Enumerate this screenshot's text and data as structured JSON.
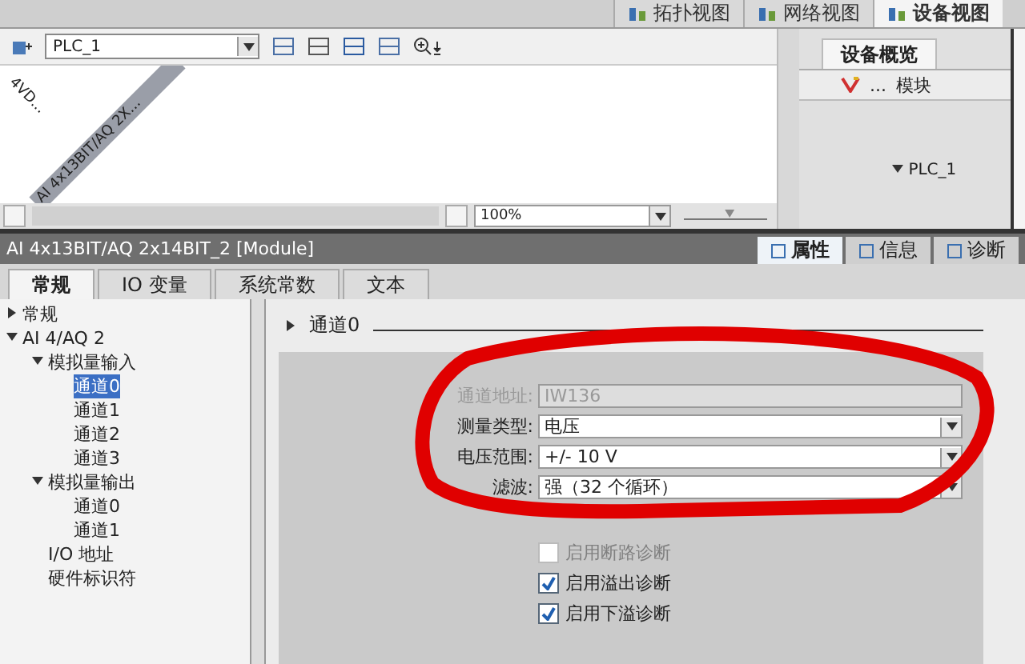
{
  "view_tabs": [
    {
      "label": "拓扑视图",
      "selected": false
    },
    {
      "label": "网络视图",
      "selected": false
    },
    {
      "label": "设备视图",
      "selected": true
    }
  ],
  "editor": {
    "device_select": "PLC_1",
    "canvas_labels": [
      "4VD...",
      "AI 4x13BIT/AQ 2X..."
    ],
    "zoom": "100%",
    "zoom_slider": {
      "level": 0.55
    }
  },
  "overview": {
    "tab": "设备概览",
    "columns": [
      "...",
      "模块"
    ],
    "rows": [
      {
        "label": "PLC_1",
        "expanded": true
      }
    ]
  },
  "inspector": {
    "title": "AI 4x13BIT/AQ 2x14BIT_2 [Module]",
    "panel_tabs": [
      {
        "label": "属性",
        "selected": true
      },
      {
        "label": "信息",
        "selected": false
      },
      {
        "label": "诊断",
        "selected": false
      }
    ],
    "tabs": [
      {
        "label": "常规",
        "selected": true
      },
      {
        "label": "IO 变量",
        "selected": false
      },
      {
        "label": "系统常数",
        "selected": false
      },
      {
        "label": "文本",
        "selected": false
      }
    ],
    "tree": [
      {
        "label": "常规",
        "expanded": false,
        "selected": false
      },
      {
        "label": "AI 4/AQ 2",
        "expanded": true,
        "selected": false,
        "children": [
          {
            "label": "模拟量输入",
            "expanded": true,
            "selected": false,
            "children": [
              {
                "label": "通道0",
                "selected": true
              },
              {
                "label": "通道1",
                "selected": false
              },
              {
                "label": "通道2",
                "selected": false
              },
              {
                "label": "通道3",
                "selected": false
              }
            ]
          },
          {
            "label": "模拟量输出",
            "expanded": true,
            "selected": false,
            "children": [
              {
                "label": "通道0",
                "selected": false
              },
              {
                "label": "通道1",
                "selected": false
              }
            ]
          },
          {
            "label": "I/O 地址",
            "selected": false
          },
          {
            "label": "硬件标识符",
            "selected": false
          }
        ]
      }
    ],
    "section": "通道0",
    "fields": [
      {
        "kind": "text",
        "label": "通道地址:",
        "value": "IW136",
        "disabled": true
      },
      {
        "kind": "dropdown",
        "label": "测量类型:",
        "value": "电压",
        "disabled": false
      },
      {
        "kind": "dropdown",
        "label": "电压范围:",
        "value": "+/- 10 V",
        "disabled": false
      },
      {
        "kind": "dropdown",
        "label": "滤波:",
        "value": "强（32 个循环）",
        "disabled": false
      }
    ],
    "checks": [
      {
        "label": "启用断路诊断",
        "checked": false,
        "disabled": true
      },
      {
        "label": "启用溢出诊断",
        "checked": true,
        "disabled": false
      },
      {
        "label": "启用下溢诊断",
        "checked": true,
        "disabled": false
      }
    ]
  },
  "highlight_mark": {
    "kind": "freehand-loop"
  }
}
